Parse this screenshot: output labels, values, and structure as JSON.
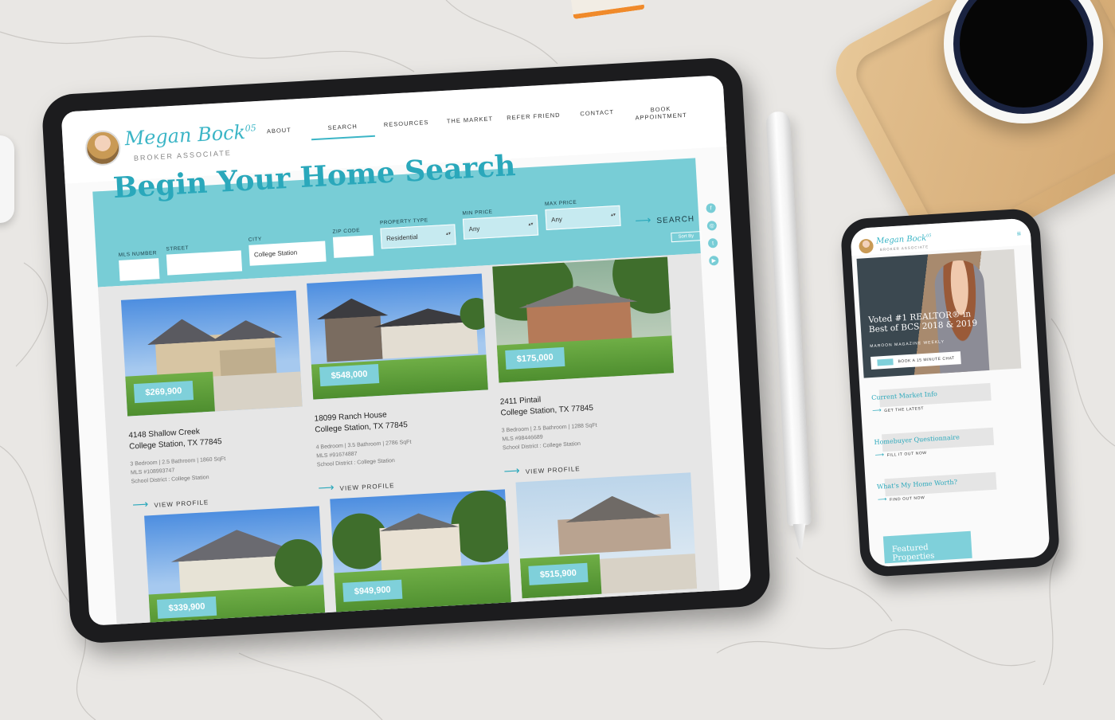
{
  "tablet": {
    "logo": {
      "name": "Megan Bock",
      "superscript": "05",
      "subtitle": "BROKER ASSOCIATE"
    },
    "nav": [
      "ABOUT",
      "SEARCH",
      "RESOURCES",
      "THE MARKET",
      "REFER FRIEND",
      "CONTACT",
      "BOOK APPOINTMENT"
    ],
    "nav_active": "SEARCH",
    "page_title": "Begin Your Home Search",
    "search": {
      "mls_label": "MLS NUMBER",
      "mls_value": "",
      "street_label": "STREET",
      "street_value": "",
      "city_label": "CITY",
      "city_value": "College Station",
      "zip_label": "ZIP CODE",
      "zip_value": "",
      "type_label": "PROPERTY TYPE",
      "type_value": "Residential",
      "min_label": "MIN PRICE",
      "min_value": "Any",
      "max_label": "MAX PRICE",
      "max_value": "Any",
      "search_button": "SEARCH",
      "sort_by": "Sort By"
    },
    "social_icons": [
      "facebook-icon",
      "instagram-icon",
      "twitter-icon",
      "youtube-icon"
    ],
    "listings": [
      {
        "price": "$269,900",
        "address_line1": "4148 Shallow Creek",
        "address_line2": "College Station, TX  77845",
        "specs": "3 Bedroom | 2.5 Bathroom | 1860 SqFt",
        "mls": "MLS #108993747",
        "school": "School District : College Station",
        "view": "VIEW PROFILE"
      },
      {
        "price": "$548,000",
        "address_line1": "18099 Ranch House",
        "address_line2": "College Station, TX  77845",
        "specs": "4 Bedroom | 3.5 Bathroom | 2786 SqFt",
        "mls": "MLS #91674887",
        "school": "School District : College Station",
        "view": "VIEW PROFILE"
      },
      {
        "price": "$175,000",
        "address_line1": "2411 Pintail",
        "address_line2": "College Station, TX  77845",
        "specs": "3 Bedroom | 2.5 Bathroom | 1288 SqFt",
        "mls": "MLS #98446689",
        "school": "School District : College Station",
        "view": "VIEW PROFILE"
      },
      {
        "price": "$339,900"
      },
      {
        "price": "$949,900"
      },
      {
        "price": "$515,900"
      }
    ]
  },
  "phone": {
    "logo": {
      "name": "Megan Bock",
      "superscript": "05",
      "subtitle": "BROKER ASSOCIATE"
    },
    "menu_icon": "hamburger-icon",
    "hero_title": "Voted #1 REALTOR® in Best of BCS 2018 & 2019",
    "hero_pub": "MAROON MAGAZINE WEEKLY",
    "hero_button": "BOOK A 15 MINUTE CHAT",
    "blocks": [
      {
        "title": "Current Market Info",
        "link": "GET THE LATEST"
      },
      {
        "title": "Homebuyer Questionnaire",
        "link": "FILL IT OUT NOW"
      },
      {
        "title": "What's My Home Worth?",
        "link": "FIND OUT NOW"
      }
    ],
    "featured": "Featured Properties"
  },
  "colors": {
    "accent": "#3bb5c6",
    "band": "#78cdd6",
    "price_tag": "#7fd0da"
  }
}
